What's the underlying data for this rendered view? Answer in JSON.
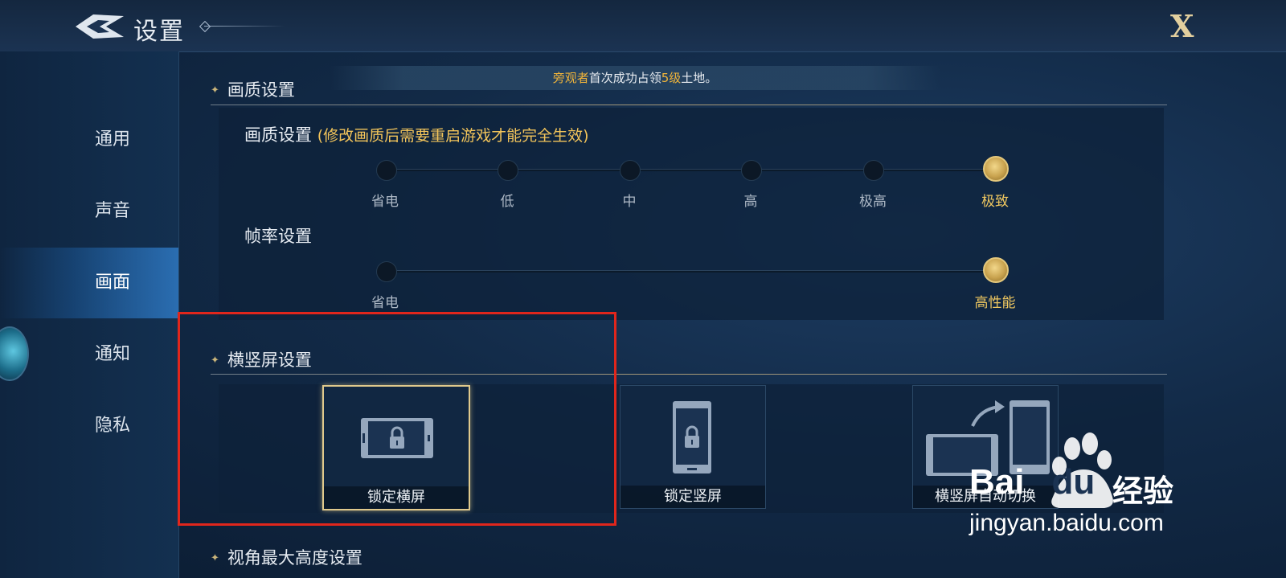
{
  "header": {
    "title": "设置",
    "close_label": "X"
  },
  "sidebar": {
    "items": [
      {
        "label": "通用",
        "active": false
      },
      {
        "label": "声音",
        "active": false
      },
      {
        "label": "画面",
        "active": true
      },
      {
        "label": "通知",
        "active": false
      },
      {
        "label": "隐私",
        "active": false
      }
    ]
  },
  "notice": {
    "name": "旁观者",
    "text1": "首次成功占领",
    "level": "5级",
    "text2": "土地。"
  },
  "quality_section": {
    "header": "画质设置",
    "quality": {
      "label": "画质设置",
      "note": "(修改画质后需要重启游戏才能完全生效)",
      "options": [
        "省电",
        "低",
        "中",
        "高",
        "极高",
        "极致"
      ],
      "selected_index": 5
    },
    "framerate": {
      "label": "帧率设置",
      "options": [
        "省电",
        "高性能"
      ],
      "selected_index": 1
    }
  },
  "orientation_section": {
    "header": "横竖屏设置",
    "options": [
      {
        "label": "锁定横屏",
        "icon": "landscape-lock-icon",
        "selected": true
      },
      {
        "label": "锁定竖屏",
        "icon": "portrait-lock-icon",
        "selected": false
      },
      {
        "label": "横竖屏自动切换",
        "icon": "auto-rotate-icon",
        "selected": false
      }
    ]
  },
  "view_section": {
    "header": "视角最大高度设置"
  },
  "watermark": {
    "brand": "Bai",
    "brand_suffix": "du",
    "product": "经验",
    "url": "jingyan.baidu.com"
  },
  "colors": {
    "accent_gold": "#e0c98c",
    "highlight_orange": "#f0b43a",
    "annotation_red": "#e0261c"
  }
}
